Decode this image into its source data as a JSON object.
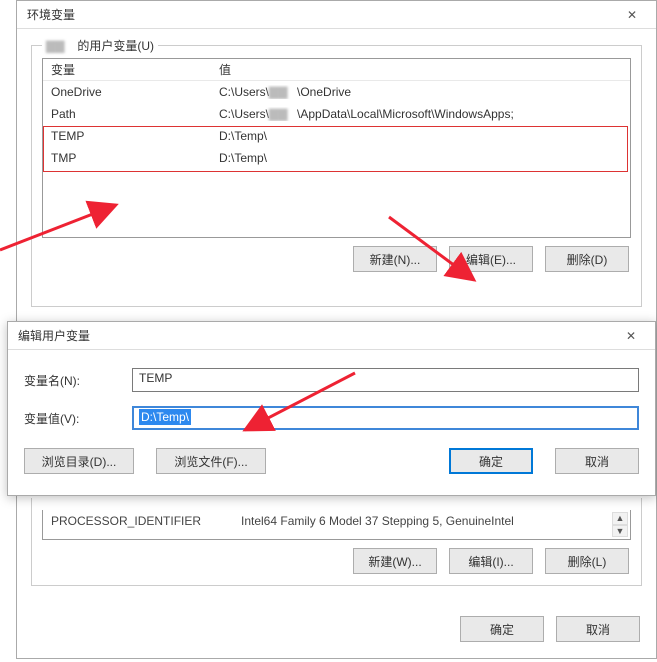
{
  "mainDialog": {
    "title": "环境变量",
    "groupUserLabelSuffix": "的用户变量(U)",
    "columns": {
      "var": "变量",
      "val": "值"
    },
    "rows": [
      {
        "var": "OneDrive",
        "val_prefix": "C:\\Users\\",
        "val_suffix": "\\OneDrive"
      },
      {
        "var": "Path",
        "val_prefix": "C:\\Users\\",
        "val_suffix": "\\AppData\\Local\\Microsoft\\WindowsApps;"
      },
      {
        "var": "TEMP",
        "val": "D:\\Temp\\"
      },
      {
        "var": "TMP",
        "val": "D:\\Temp\\"
      }
    ],
    "buttons": {
      "new": "新建(N)...",
      "edit": "编辑(E)...",
      "delete": "删除(D)"
    },
    "sysRow": {
      "var": "PROCESSOR_IDENTIFIER",
      "val": "Intel64 Family 6 Model 37 Stepping 5, GenuineIntel"
    },
    "sysButtons": {
      "new": "新建(W)...",
      "edit": "编辑(I)...",
      "delete": "删除(L)"
    },
    "footer": {
      "ok": "确定",
      "cancel": "取消"
    }
  },
  "editDialog": {
    "title": "编辑用户变量",
    "labels": {
      "name": "变量名(N):",
      "value": "变量值(V):"
    },
    "nameValue": "TEMP",
    "valueValue": "D:\\Temp\\",
    "buttons": {
      "browseDir": "浏览目录(D)...",
      "browseFile": "浏览文件(F)...",
      "ok": "确定",
      "cancel": "取消"
    }
  }
}
